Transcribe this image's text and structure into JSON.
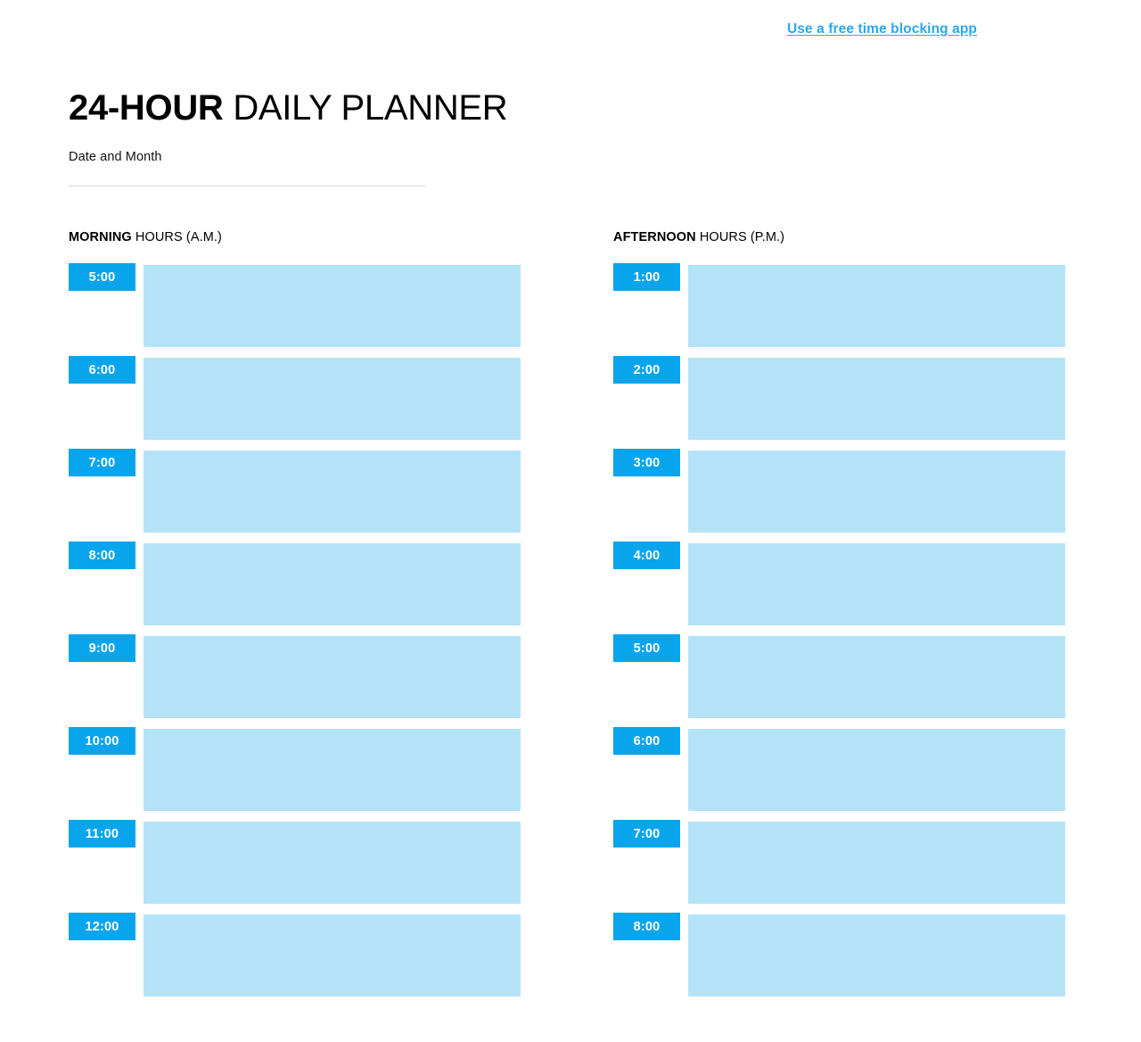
{
  "promo": {
    "link_label": "Use a free time blocking app"
  },
  "title": {
    "strong": "24-HOUR",
    "rest": " DAILY PLANNER"
  },
  "date_field": {
    "label": "Date and Month",
    "value": ""
  },
  "columns": [
    {
      "heading_strong": "MORNING",
      "heading_rest": " HOURS (A.M.)",
      "rows": [
        {
          "time": "5:00",
          "note": ""
        },
        {
          "time": "6:00",
          "note": ""
        },
        {
          "time": "7:00",
          "note": ""
        },
        {
          "time": "8:00",
          "note": ""
        },
        {
          "time": "9:00",
          "note": ""
        },
        {
          "time": "10:00",
          "note": ""
        },
        {
          "time": "11:00",
          "note": ""
        },
        {
          "time": "12:00",
          "note": ""
        }
      ]
    },
    {
      "heading_strong": "AFTERNOON",
      "heading_rest": " HOURS (P.M.)",
      "rows": [
        {
          "time": "1:00",
          "note": ""
        },
        {
          "time": "2:00",
          "note": ""
        },
        {
          "time": "3:00",
          "note": ""
        },
        {
          "time": "4:00",
          "note": ""
        },
        {
          "time": "5:00",
          "note": ""
        },
        {
          "time": "6:00",
          "note": ""
        },
        {
          "time": "7:00",
          "note": ""
        },
        {
          "time": "8:00",
          "note": ""
        }
      ]
    }
  ],
  "colors": {
    "chip_blue": "#09a5ec",
    "block_blue": "#b4e3f8",
    "link_blue": "#2aa9e8",
    "rule_gray": "#d9dadb"
  }
}
